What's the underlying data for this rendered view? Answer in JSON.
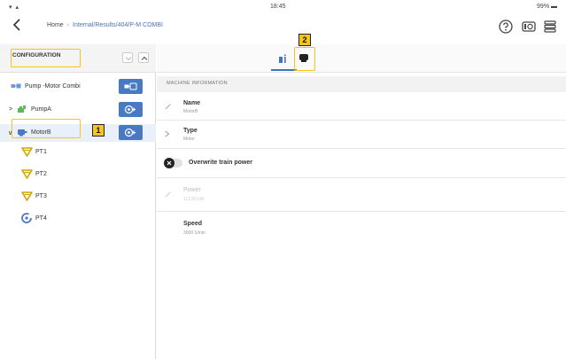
{
  "statusbar": {
    "signal": "▾ ▴",
    "time": "18:45",
    "battery": "99% ▬"
  },
  "header": {
    "back_icon": "chevron-left-icon",
    "breadcrumb": {
      "home": "Home",
      "separator": "›",
      "path": "Internal/Results/404/P-M COMBI"
    },
    "icons": [
      "help-icon",
      "camera-toggle-icon",
      "menu-icon"
    ]
  },
  "left": {
    "title": "CONFIGURATION",
    "tree": [
      {
        "label": "Pump -Motor Combi",
        "icon": "machine-train-icon"
      },
      {
        "label": "PumpA",
        "icon": "pump-icon",
        "expander": ">"
      },
      {
        "label": "MotorB",
        "icon": "motor-icon",
        "expander": "∨",
        "selected": true
      }
    ],
    "points": [
      {
        "label": "PT1",
        "icon": "vibration-point-icon"
      },
      {
        "label": "PT2",
        "icon": "vibration-point-icon"
      },
      {
        "label": "PT3",
        "icon": "vibration-point-icon"
      },
      {
        "label": "PT4",
        "icon": "speed-point-icon"
      }
    ],
    "badge": "1"
  },
  "right": {
    "badge": "2",
    "section_title": "MACHINE INFORMATION",
    "name": {
      "title": "Name",
      "value": "MotorB"
    },
    "type": {
      "title": "Type",
      "value": "Motor"
    },
    "overwrite": {
      "label": "Overwrite train power",
      "on": false
    },
    "power": {
      "title": "Power",
      "value": "112.50 kW"
    },
    "speed": {
      "title": "Speed",
      "value": "3000 1/min"
    }
  },
  "colors": {
    "accent": "#4a79c4",
    "highlight": "#f5c518",
    "warning": "#f5c518"
  }
}
